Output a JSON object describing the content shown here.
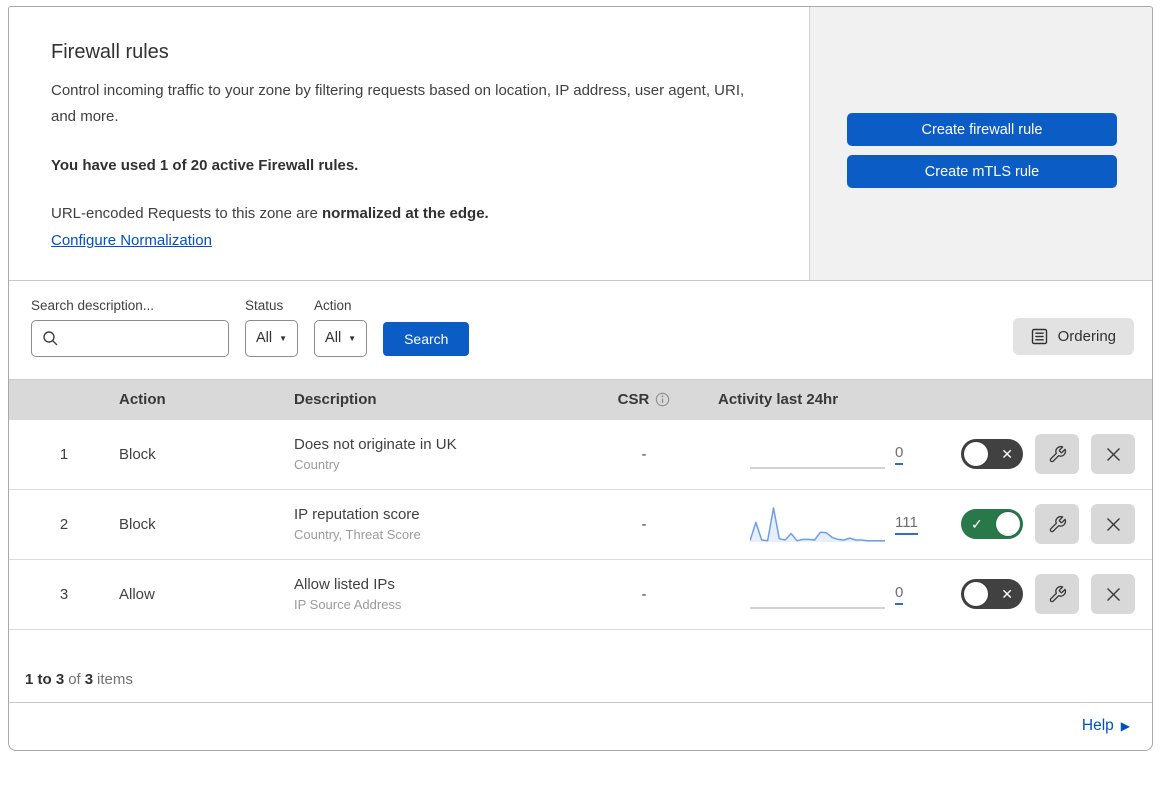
{
  "header": {
    "title": "Firewall rules",
    "description": "Control incoming traffic to your zone by filtering requests based on location, IP address, user agent, URI, and more.",
    "usage": "You have used 1 of 20 active Firewall rules.",
    "normalization_prefix": "URL-encoded Requests to this zone are",
    "normalization_bold": "normalized at the edge.",
    "normalization_link": "Configure Normalization"
  },
  "actions_panel": {
    "create_firewall_rule": "Create firewall rule",
    "create_mtls_rule": "Create mTLS rule"
  },
  "filters": {
    "search_label": "Search description...",
    "status_label": "Status",
    "status_value": "All",
    "action_label": "Action",
    "action_value": "All",
    "search_button": "Search",
    "ordering_button": "Ordering"
  },
  "table": {
    "columns": {
      "action": "Action",
      "description": "Description",
      "csr": "CSR",
      "activity": "Activity last 24hr"
    },
    "rows": [
      {
        "number": "1",
        "action": "Block",
        "description": "Does not originate in UK",
        "criteria": "Country",
        "csr": "-",
        "activity_count": "0",
        "enabled": false,
        "sparkline": []
      },
      {
        "number": "2",
        "action": "Block",
        "description": "IP reputation score",
        "criteria": "Country, Threat Score",
        "csr": "-",
        "activity_count": "111",
        "enabled": true,
        "sparkline": [
          2,
          30,
          3,
          2,
          52,
          5,
          3,
          13,
          2,
          4,
          4,
          3,
          15,
          14,
          7,
          4,
          3,
          6,
          3,
          3,
          2,
          2,
          2,
          2
        ]
      },
      {
        "number": "3",
        "action": "Allow",
        "description": "Allow listed IPs",
        "criteria": "IP Source Address",
        "csr": "-",
        "activity_count": "0",
        "enabled": false,
        "sparkline": []
      }
    ],
    "footer": {
      "range_bold": "1 to 3",
      "of_text": "of",
      "total_bold": "3",
      "items_text": "items"
    }
  },
  "help": {
    "label": "Help"
  },
  "colors": {
    "accent_blue": "#0b5cc4",
    "link_blue": "#0051c3",
    "toggle_on_green": "#28784a",
    "toggle_off_gray": "#414141",
    "sparkline_blue": "#6d9ee8",
    "header_bar_gray": "#d9d9d9",
    "side_panel_gray": "#f1f1f1"
  }
}
